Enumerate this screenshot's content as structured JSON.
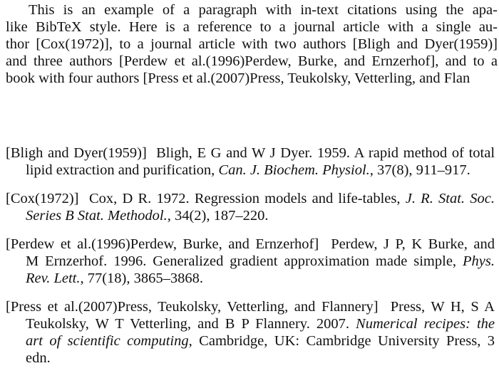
{
  "paragraph": {
    "lines": [
      "This is an example of a paragraph with in-text citations using the apa-",
      "like BibTeX style.  Here is a reference to a journal article with a single au-",
      "thor [Cox(1972)], to a journal article with two authors [Bligh and Dyer(1959)]",
      "and three authors [Perdew et al.(1996)Perdew, Burke, and Ernzerhof], and to a",
      "book with four authors [Press et al.(2007)Press, Teukolsky, Vetterling, and Flan"
    ]
  },
  "bibliography": [
    {
      "key": "[Bligh and Dyer(1959)]",
      "line1_rest": "Bligh, E G and W J Dyer. 1959. A rapid method of total",
      "line2_plain": "lipid extraction and purification, ",
      "line2_italic": "Can. J. Biochem. Physiol.",
      "line2_tail": ", 37(8), 911–917."
    },
    {
      "key": "[Cox(1972)]",
      "line1_rest": "Cox, D R. 1972. Regression models and life-tables, ",
      "line1_italic": "J. R. Stat. Soc.",
      "line2_italic": "Series B Stat. Methodol.",
      "line2_tail": ", 34(2), 187–220."
    },
    {
      "key": "[Perdew et al.(1996)Perdew, Burke, and Ernzerhof]",
      "line1_rest": "Perdew, J P, K Burke, and",
      "line2_plain": "M Ernzerhof. 1996. Generalized gradient approximation made simple, ",
      "line2_italic": "Phys.",
      "line3_italic": "Rev. Lett.",
      "line3_tail": ", 77(18), 3865–3868."
    },
    {
      "key": "[Press et al.(2007)Press, Teukolsky, Vetterling, and Flannery]",
      "line1_rest": "Press, W H, S A",
      "line2_plain": "Teukolsky, W T Vetterling, and B P Flannery. 2007. ",
      "line2_italic": "Numerical recipes: the",
      "line3_italic": "art of scientific computing",
      "line3_tail": ", Cambridge, UK: Cambridge University Press, 3",
      "line4_plain": "edn."
    }
  ]
}
